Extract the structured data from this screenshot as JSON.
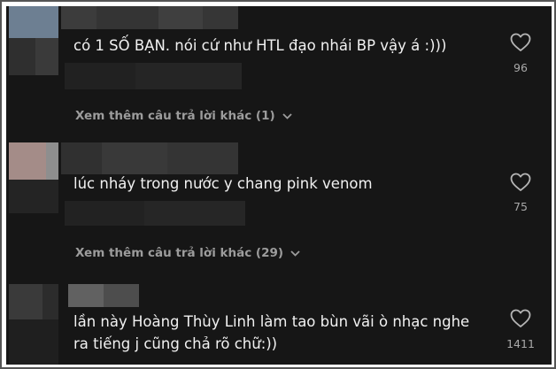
{
  "comments": [
    {
      "text": "có 1 SỐ BẠN. nói cứ như HTL đạo nhái BP vậy á :)))",
      "likes": "96",
      "replies_label": "Xem thêm câu trả lời khác (1)",
      "like_icon": "heart-outline-icon"
    },
    {
      "text": "lúc nháy trong nước y chang pink venom",
      "likes": "75",
      "replies_label": "Xem thêm câu trả lời khác (29)",
      "like_icon": "heart-outline-icon"
    },
    {
      "text_lines": [
        "lần này Hoàng Thùy Linh làm tao bùn vãi ò nhạc nghe",
        "ra tiếng j cũng chả rõ chữ:))"
      ],
      "likes": "1411",
      "like_icon": "heart-outline-icon"
    }
  ],
  "colors": {
    "background": "#161616",
    "text": "#f1f1f1",
    "muted": "#9c9c9c"
  }
}
